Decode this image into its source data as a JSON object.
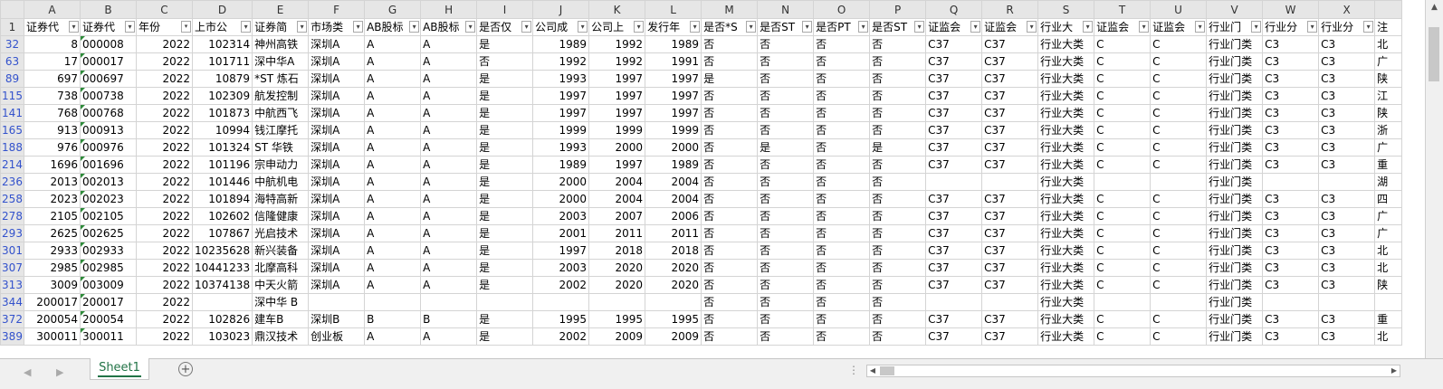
{
  "columns": [
    "A",
    "B",
    "C",
    "D",
    "E",
    "F",
    "G",
    "H",
    "I",
    "J",
    "K",
    "L",
    "M",
    "N",
    "O",
    "P",
    "Q",
    "R",
    "S",
    "T",
    "U",
    "V",
    "W",
    "X"
  ],
  "col_widths": [
    62,
    62,
    62,
    62,
    62,
    62,
    62,
    62,
    62,
    62,
    62,
    62,
    62,
    62,
    62,
    62,
    62,
    62,
    62,
    62,
    62,
    62,
    62,
    62
  ],
  "header_row_num": "1",
  "headers": [
    "证券代",
    "证券代",
    "年份",
    "上市公",
    "证券简",
    "市场类",
    "AB股标",
    "AB股标",
    "是否仅",
    "公司成",
    "公司上",
    "发行年",
    "是否*S",
    "是否ST",
    "是否PT",
    "是否ST",
    "证监会",
    "证监会",
    "行业大",
    "证监会",
    "证监会",
    "行业门",
    "行业分",
    "行业分"
  ],
  "filter_active_col": 2,
  "last_col_partial": "注",
  "right_align_cols": [
    0,
    2,
    3,
    9,
    10,
    11
  ],
  "tri_col": 1,
  "rows": [
    {
      "n": "32",
      "c": [
        "8",
        "000008",
        "2022",
        "102314",
        "神州高铁",
        "深圳A",
        "A",
        "A",
        "是",
        "1989",
        "1992",
        "1989",
        "否",
        "否",
        "否",
        "否",
        "C37",
        "C37",
        "行业大类",
        "C",
        "C",
        "行业门类",
        "C3",
        "C3",
        "北"
      ]
    },
    {
      "n": "63",
      "c": [
        "17",
        "000017",
        "2022",
        "101711",
        "深中华A",
        "深圳A",
        "A",
        "A",
        "否",
        "1992",
        "1992",
        "1991",
        "否",
        "否",
        "否",
        "否",
        "C37",
        "C37",
        "行业大类",
        "C",
        "C",
        "行业门类",
        "C3",
        "C3",
        "广"
      ]
    },
    {
      "n": "89",
      "c": [
        "697",
        "000697",
        "2022",
        "10879",
        "*ST 炼石",
        "深圳A",
        "A",
        "A",
        "是",
        "1993",
        "1997",
        "1997",
        "是",
        "否",
        "否",
        "否",
        "C37",
        "C37",
        "行业大类",
        "C",
        "C",
        "行业门类",
        "C3",
        "C3",
        "陕"
      ]
    },
    {
      "n": "115",
      "c": [
        "738",
        "000738",
        "2022",
        "102309",
        "航发控制",
        "深圳A",
        "A",
        "A",
        "是",
        "1997",
        "1997",
        "1997",
        "否",
        "否",
        "否",
        "否",
        "C37",
        "C37",
        "行业大类",
        "C",
        "C",
        "行业门类",
        "C3",
        "C3",
        "江"
      ]
    },
    {
      "n": "141",
      "c": [
        "768",
        "000768",
        "2022",
        "101873",
        "中航西飞",
        "深圳A",
        "A",
        "A",
        "是",
        "1997",
        "1997",
        "1997",
        "否",
        "否",
        "否",
        "否",
        "C37",
        "C37",
        "行业大类",
        "C",
        "C",
        "行业门类",
        "C3",
        "C3",
        "陕"
      ]
    },
    {
      "n": "165",
      "c": [
        "913",
        "000913",
        "2022",
        "10994",
        "钱江摩托",
        "深圳A",
        "A",
        "A",
        "是",
        "1999",
        "1999",
        "1999",
        "否",
        "否",
        "否",
        "否",
        "C37",
        "C37",
        "行业大类",
        "C",
        "C",
        "行业门类",
        "C3",
        "C3",
        "浙"
      ]
    },
    {
      "n": "188",
      "c": [
        "976",
        "000976",
        "2022",
        "101324",
        "ST 华铁",
        "深圳A",
        "A",
        "A",
        "是",
        "1993",
        "2000",
        "2000",
        "否",
        "是",
        "否",
        "是",
        "C37",
        "C37",
        "行业大类",
        "C",
        "C",
        "行业门类",
        "C3",
        "C3",
        "广"
      ]
    },
    {
      "n": "214",
      "c": [
        "1696",
        "001696",
        "2022",
        "101196",
        "宗申动力",
        "深圳A",
        "A",
        "A",
        "是",
        "1989",
        "1997",
        "1989",
        "否",
        "否",
        "否",
        "否",
        "C37",
        "C37",
        "行业大类",
        "C",
        "C",
        "行业门类",
        "C3",
        "C3",
        "重"
      ]
    },
    {
      "n": "236",
      "c": [
        "2013",
        "002013",
        "2022",
        "101446",
        "中航机电",
        "深圳A",
        "A",
        "A",
        "是",
        "2000",
        "2004",
        "2004",
        "否",
        "否",
        "否",
        "否",
        "",
        "",
        "行业大类",
        "",
        "",
        "行业门类",
        "",
        "",
        "湖"
      ]
    },
    {
      "n": "258",
      "c": [
        "2023",
        "002023",
        "2022",
        "101894",
        "海特高新",
        "深圳A",
        "A",
        "A",
        "是",
        "2000",
        "2004",
        "2004",
        "否",
        "否",
        "否",
        "否",
        "C37",
        "C37",
        "行业大类",
        "C",
        "C",
        "行业门类",
        "C3",
        "C3",
        "四"
      ]
    },
    {
      "n": "278",
      "c": [
        "2105",
        "002105",
        "2022",
        "102602",
        "信隆健康",
        "深圳A",
        "A",
        "A",
        "是",
        "2003",
        "2007",
        "2006",
        "否",
        "否",
        "否",
        "否",
        "C37",
        "C37",
        "行业大类",
        "C",
        "C",
        "行业门类",
        "C3",
        "C3",
        "广"
      ]
    },
    {
      "n": "293",
      "c": [
        "2625",
        "002625",
        "2022",
        "107867",
        "光启技术",
        "深圳A",
        "A",
        "A",
        "是",
        "2001",
        "2011",
        "2011",
        "否",
        "否",
        "否",
        "否",
        "C37",
        "C37",
        "行业大类",
        "C",
        "C",
        "行业门类",
        "C3",
        "C3",
        "广"
      ]
    },
    {
      "n": "301",
      "c": [
        "2933",
        "002933",
        "2022",
        "10235628",
        "新兴装备",
        "深圳A",
        "A",
        "A",
        "是",
        "1997",
        "2018",
        "2018",
        "否",
        "否",
        "否",
        "否",
        "C37",
        "C37",
        "行业大类",
        "C",
        "C",
        "行业门类",
        "C3",
        "C3",
        "北"
      ]
    },
    {
      "n": "307",
      "c": [
        "2985",
        "002985",
        "2022",
        "10441233",
        "北摩高科",
        "深圳A",
        "A",
        "A",
        "是",
        "2003",
        "2020",
        "2020",
        "否",
        "否",
        "否",
        "否",
        "C37",
        "C37",
        "行业大类",
        "C",
        "C",
        "行业门类",
        "C3",
        "C3",
        "北"
      ]
    },
    {
      "n": "313",
      "c": [
        "3009",
        "003009",
        "2022",
        "10374138",
        "中天火箭",
        "深圳A",
        "A",
        "A",
        "是",
        "2002",
        "2020",
        "2020",
        "否",
        "否",
        "否",
        "否",
        "C37",
        "C37",
        "行业大类",
        "C",
        "C",
        "行业门类",
        "C3",
        "C3",
        "陕"
      ]
    },
    {
      "n": "344",
      "c": [
        "200017",
        "200017",
        "2022",
        "",
        "深中华 B",
        "",
        "",
        "",
        "",
        "",
        "",
        "",
        "否",
        "否",
        "否",
        "否",
        "",
        "",
        "行业大类",
        "",
        "",
        "行业门类",
        "",
        "",
        ""
      ]
    },
    {
      "n": "372",
      "c": [
        "200054",
        "200054",
        "2022",
        "102826",
        "建车B",
        "深圳B",
        "B",
        "B",
        "是",
        "1995",
        "1995",
        "1995",
        "否",
        "否",
        "否",
        "否",
        "C37",
        "C37",
        "行业大类",
        "C",
        "C",
        "行业门类",
        "C3",
        "C3",
        "重"
      ]
    },
    {
      "n": "389",
      "c": [
        "300011",
        "300011",
        "2022",
        "103023",
        "鼎汉技术",
        "创业板",
        "A",
        "A",
        "是",
        "2002",
        "2009",
        "2009",
        "否",
        "否",
        "否",
        "否",
        "C37",
        "C37",
        "行业大类",
        "C",
        "C",
        "行业门类",
        "C3",
        "C3",
        "北"
      ]
    }
  ],
  "sheet_tab": "Sheet1",
  "add_sheet_icon": "+",
  "nav_prev": "◀",
  "nav_next": "▶",
  "dots": "⋮",
  "scroll_left": "◀",
  "scroll_right": "▶",
  "scroll_up": "▲",
  "scroll_down": "▼",
  "filter_glyph": "▾",
  "filter_active_glyph": "▾"
}
